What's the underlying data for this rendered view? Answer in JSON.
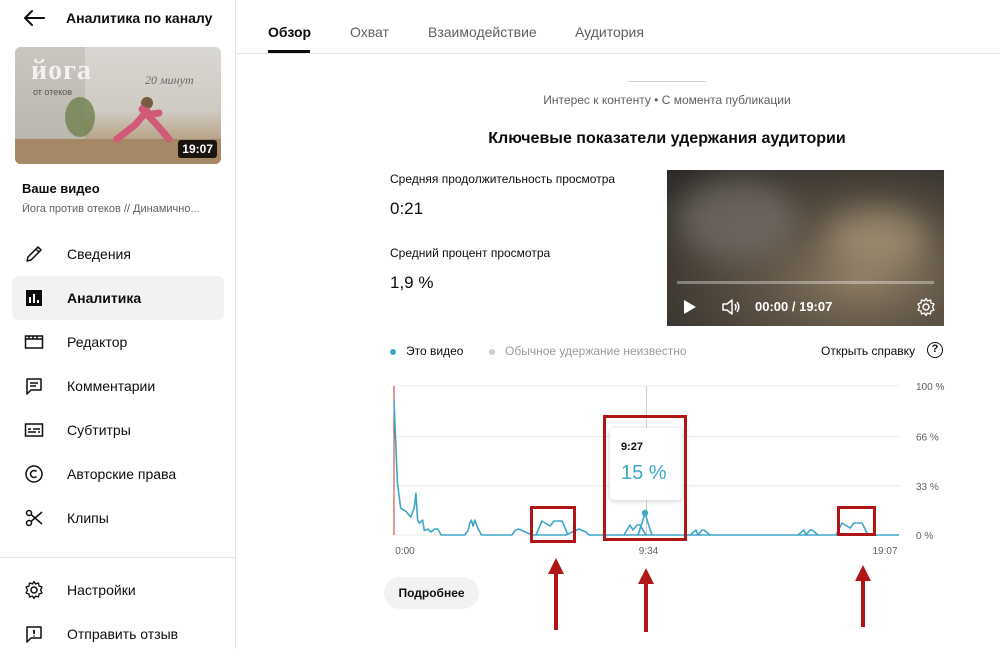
{
  "sidebar": {
    "title": "Аналитика по каналу",
    "thumbnail": {
      "logo_main": "йога",
      "logo_sub": "от отеков",
      "minutes_text": "20 минут",
      "duration": "19:07"
    },
    "your_video_label": "Ваше видео",
    "video_title": "Йога против отеков // Динамично...",
    "items": [
      {
        "label": "Сведения",
        "icon": "pencil-icon"
      },
      {
        "label": "Аналитика",
        "icon": "analytics-icon"
      },
      {
        "label": "Редактор",
        "icon": "editor-icon"
      },
      {
        "label": "Комментарии",
        "icon": "comment-icon"
      },
      {
        "label": "Субтитры",
        "icon": "subtitles-icon"
      },
      {
        "label": "Авторские права",
        "icon": "copyright-icon"
      },
      {
        "label": "Клипы",
        "icon": "scissors-icon"
      }
    ],
    "bottom_items": [
      {
        "label": "Настройки",
        "icon": "gear-icon"
      },
      {
        "label": "Отправить отзыв",
        "icon": "feedback-icon"
      }
    ]
  },
  "tabs": [
    {
      "label": "Обзор",
      "active": true
    },
    {
      "label": "Охват",
      "active": false
    },
    {
      "label": "Взаимодействие",
      "active": false
    },
    {
      "label": "Аудитория",
      "active": false
    }
  ],
  "main": {
    "subtitle": "Интерес к контенту • С момента публикации",
    "section_title": "Ключевые показатели удержания аудитории",
    "metrics": [
      {
        "label": "Средняя продолжительность просмотра",
        "value": "0:21"
      },
      {
        "label": "Средний процент просмотра",
        "value": "1,9 %"
      }
    ],
    "player": {
      "time": "00:00 / 19:07"
    },
    "legend": {
      "this_video": "Это видео",
      "typical": "Обычное удержание неизвестно",
      "this_color": "#3ea6c8",
      "typical_color": "#d0d0d0"
    },
    "help_link": "Открыть справку",
    "help_icon_glyph": "?",
    "more_button": "Подробнее"
  },
  "chart_data": {
    "type": "line",
    "x_tick_labels": [
      "0:00",
      "9:34",
      "19:07"
    ],
    "y_tick_labels": [
      "100 %",
      "66 %",
      "33 %",
      "0 %"
    ],
    "ylim": [
      0,
      100
    ],
    "series": [
      {
        "name": "Это видео",
        "color": "#3ea6c8",
        "x": [
          0,
          0.02,
          0.04,
          0.07,
          0.1,
          0.12,
          0.13,
          0.14,
          0.15,
          0.17,
          0.18,
          0.2,
          0.22,
          0.24,
          0.26,
          0.28,
          0.3,
          0.34,
          0.38,
          0.42,
          0.44,
          0.45,
          0.46,
          0.47,
          0.48,
          0.5,
          0.52,
          0.56,
          0.6,
          0.64,
          0.68,
          0.7,
          0.72,
          0.74,
          0.78,
          0.82,
          0.84,
          0.86,
          0.88,
          0.92,
          0.94,
          0.96,
          0.98,
          1.0,
          1.02,
          1.06,
          1.1,
          1.14,
          1.16,
          1.17,
          1.18,
          1.19,
          1.2,
          1.22,
          1.24,
          1.3,
          1.34,
          1.36,
          1.38,
          1.42,
          1.46,
          1.5,
          1.54,
          1.58,
          1.62,
          1.64,
          1.66,
          1.67,
          1.68,
          1.69,
          1.7,
          1.72,
          1.74,
          1.76,
          1.78,
          1.8,
          1.82,
          1.84,
          1.86,
          1.88,
          1.9,
          1.92,
          1.94,
          1.96,
          1.98,
          2.0,
          2.02,
          2.04,
          2.06,
          2.08,
          2.1,
          2.12,
          2.14,
          2.16,
          2.18,
          2.2,
          2.22,
          2.24,
          2.26,
          2.28,
          2.3,
          2.32,
          2.34,
          2.36,
          2.38,
          2.4,
          2.42,
          2.44,
          2.46,
          2.48,
          2.5,
          2.52,
          2.54,
          2.56,
          2.58,
          2.6,
          2.62,
          2.64,
          2.66,
          2.68,
          2.7,
          2.72,
          2.74,
          2.76,
          2.78,
          2.8,
          2.82,
          2.84,
          2.86,
          2.88,
          2.9,
          2.92,
          2.94,
          2.96,
          2.98,
          3.0
        ],
        "values": [
          90,
          35,
          18,
          16,
          12,
          18,
          28,
          10,
          8,
          10,
          3,
          4,
          2,
          4,
          4,
          0,
          0,
          0,
          0,
          0,
          3,
          8,
          10,
          6,
          10,
          4,
          0,
          0,
          0,
          0,
          0,
          0,
          3,
          4,
          2,
          0,
          0,
          0,
          0,
          0,
          0,
          0,
          0,
          0,
          0,
          2,
          4,
          2,
          0,
          0,
          0,
          0,
          0,
          0,
          0,
          0,
          0,
          0,
          0,
          0,
          0,
          0,
          0,
          0,
          0,
          0,
          0,
          0,
          0,
          0,
          0,
          0,
          0,
          0,
          0,
          0,
          0,
          0,
          0,
          0,
          0,
          0,
          0,
          0,
          0,
          0,
          0,
          0,
          0,
          0,
          0,
          0,
          0,
          0,
          0,
          0,
          0,
          0,
          0,
          0,
          0,
          0,
          0,
          0,
          0,
          0,
          0,
          0,
          0,
          0,
          0,
          0,
          0,
          0,
          0,
          0,
          0,
          0,
          0,
          0,
          0,
          0,
          0,
          0,
          0,
          0,
          0,
          0,
          0,
          0,
          0,
          0,
          0,
          0,
          0,
          0
        ]
      }
    ],
    "grid": true,
    "tooltip": {
      "time": "9:27",
      "value": "15 %"
    }
  }
}
